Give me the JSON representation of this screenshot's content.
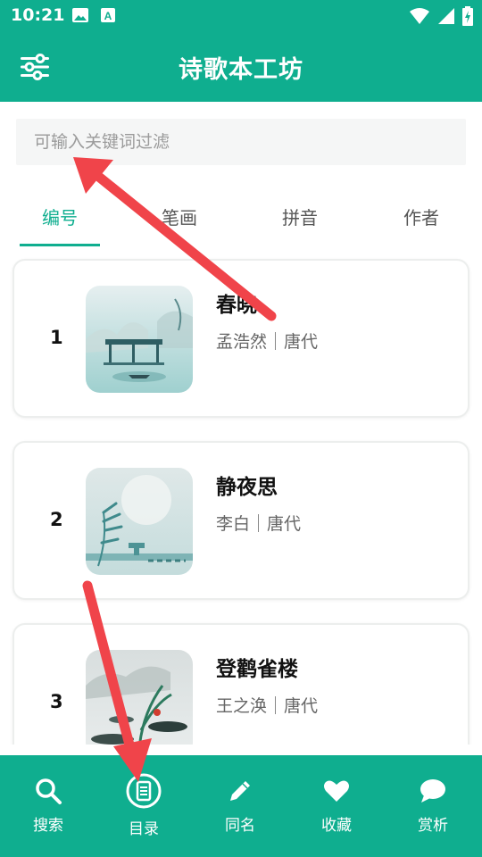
{
  "status_bar": {
    "time": "10:21"
  },
  "header": {
    "title": "诗歌本工坊"
  },
  "search": {
    "placeholder": "可输入关键词过滤"
  },
  "tabs": [
    {
      "label": "编号",
      "active": true
    },
    {
      "label": "笔画",
      "active": false
    },
    {
      "label": "拼音",
      "active": false
    },
    {
      "label": "作者",
      "active": false
    }
  ],
  "poems": [
    {
      "number": "1",
      "title": "春晓",
      "author": "孟浩然",
      "dynasty": "唐代"
    },
    {
      "number": "2",
      "title": "静夜思",
      "author": "李白",
      "dynasty": "唐代"
    },
    {
      "number": "3",
      "title": "登鹳雀楼",
      "author": "王之涣",
      "dynasty": "唐代"
    }
  ],
  "bottom_nav": [
    {
      "label": "搜索",
      "icon": "search-icon"
    },
    {
      "label": "目录",
      "icon": "catalog-icon"
    },
    {
      "label": "同名",
      "icon": "pen-icon"
    },
    {
      "label": "收藏",
      "icon": "heart-icon"
    },
    {
      "label": "赏析",
      "icon": "chat-bubble-icon"
    }
  ],
  "colors": {
    "primary": "#0fae8f",
    "arrow": "#f0444a"
  }
}
